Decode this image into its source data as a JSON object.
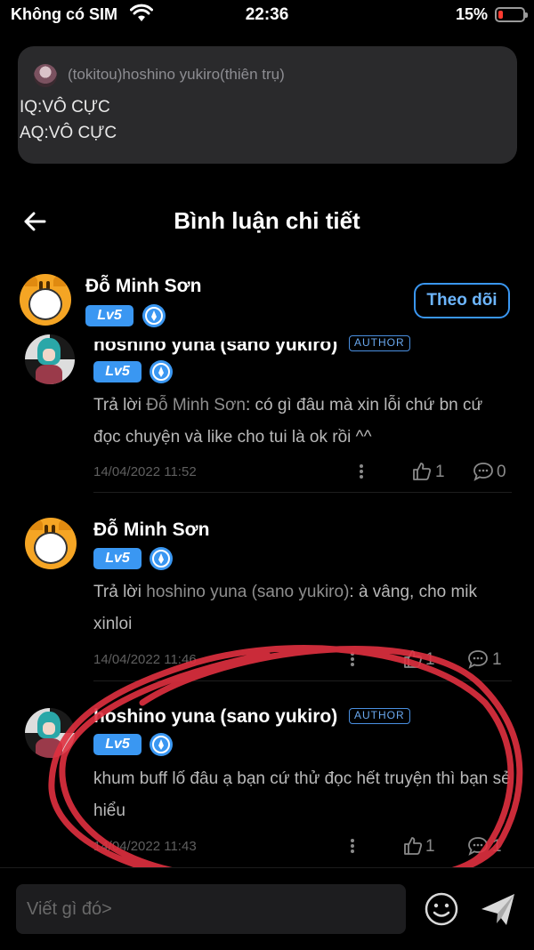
{
  "status_bar": {
    "carrier": "Không có SIM",
    "time": "22:36",
    "battery": "15%",
    "battery_color": "#ff3b30"
  },
  "notification": {
    "sender": "(tokitou)hoshino yukiro(thiên trụ)",
    "lines": [
      "IQ:VÔ CỰC",
      "AQ:VÔ CỰC"
    ]
  },
  "header": {
    "title": "Bình luận chi tiết",
    "back_icon": "arrow-left-icon"
  },
  "top_comment": {
    "author": "Đỗ Minh Sơn",
    "level": "Lv5",
    "follow_label": "Theo dõi",
    "accent": "#3a97f2"
  },
  "replies": [
    {
      "author": "hoshino yuna (sano yukiro)",
      "tag": "AUTHOR",
      "level": "Lv5",
      "reply_prefix": "Trả lời ",
      "reply_to": "Đỗ Minh Sơn",
      "text": ": có gì đâu mà xin lỗi chứ bn cứ đọc chuyện và like cho tui là ok rồi ^^",
      "date": "14/04/2022 11:52",
      "likes": "1",
      "comments": "0"
    },
    {
      "author": "Đỗ Minh Sơn",
      "level": "Lv5",
      "reply_prefix": "Trả lời ",
      "reply_to": "hoshino yuna (sano yukiro)",
      "text": ": à vâng, cho mik xinloi",
      "date": "14/04/2022 11:46",
      "likes": "1",
      "comments": "1"
    },
    {
      "author": "hoshino yuna (sano yukiro)",
      "tag": "AUTHOR",
      "level": "Lv5",
      "text": "khum buff lố đâu ạ bạn cứ thử đọc hết truyện thì bạn sẻ hiểu",
      "date": "14/04/2022 11:43",
      "likes": "1",
      "comments": "1"
    }
  ],
  "composer": {
    "placeholder": "Viết gì đó>",
    "emoji_icon": "smiley-icon",
    "send_icon": "paper-plane-icon"
  },
  "annotation_color": "#e0303f"
}
